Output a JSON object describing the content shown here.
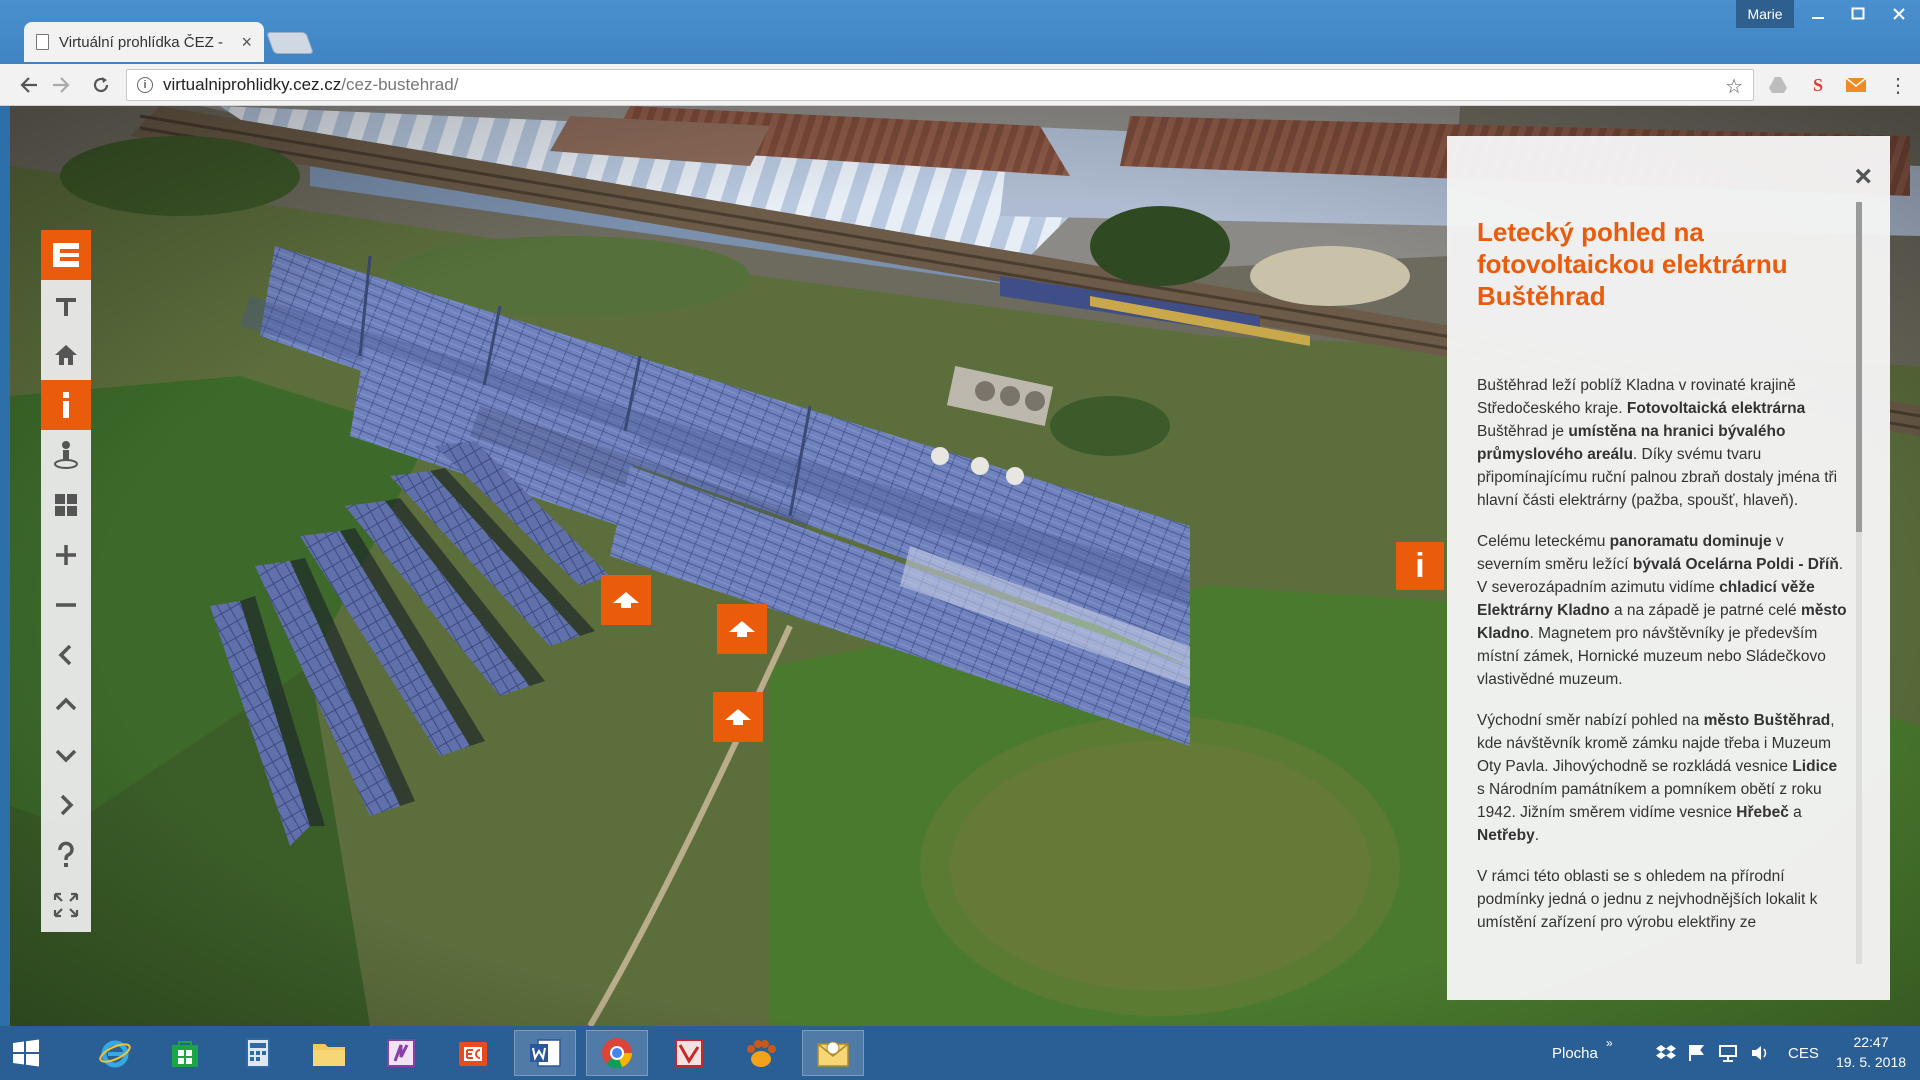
{
  "browser": {
    "tab_title": "Virtuální prohlídka ČEZ -",
    "tab_close": "×",
    "user": "Marie",
    "url_host": "virtualniprohlidky.cez.cz",
    "url_path": "/cez-bustehrad/"
  },
  "panel": {
    "close": "×",
    "title": "Letecký pohled na fotovoltaickou elektrárnu Buštěhrad",
    "p1": [
      {
        "t": "Buštěhrad leží poblíž Kladna v rovinaté krajině Středočeského kraje. "
      },
      {
        "t": "Fotovoltaická elektrárna",
        "b": true
      },
      {
        "t": " Buštěhrad je "
      },
      {
        "t": "umístěna na hranici bývalého průmyslového areálu",
        "b": true
      },
      {
        "t": ". Díky svému tvaru připomínajícímu ruční palnou zbraň dostaly jména tři hlavní části elektrárny (pažba, spoušť, hlaveň)."
      }
    ],
    "p2": [
      {
        "t": "Celému leteckému "
      },
      {
        "t": "panoramatu dominuje",
        "b": true
      },
      {
        "t": " v severním směru ležící "
      },
      {
        "t": "bývalá Ocelárna Poldi - Dříň",
        "b": true
      },
      {
        "t": ". V severozápadním azimutu vidíme "
      },
      {
        "t": "chladicí věže Elektrárny Kladno",
        "b": true
      },
      {
        "t": " a na západě je patrné celé "
      },
      {
        "t": "město Kladno",
        "b": true
      },
      {
        "t": ". Magnetem pro návštěvníky je především místní zámek, Hornické muzeum nebo Sládečkovo vlastivědné muzeum."
      }
    ],
    "p3": [
      {
        "t": "Východní směr nabízí pohled na "
      },
      {
        "t": "město Buštěhrad",
        "b": true
      },
      {
        "t": ", kde návštěvník kromě zámku najde třeba i Muzeum Oty Pavla. Jihovýchodně se rozkládá vesnice "
      },
      {
        "t": "Lidice",
        "b": true
      },
      {
        "t": " s Národním památníkem a pomníkem obětí z roku 1942. Jižním směrem vidíme vesnice "
      },
      {
        "t": "Hřebeč",
        "b": true
      },
      {
        "t": " a "
      },
      {
        "t": "Netřeby",
        "b": true
      },
      {
        "t": "."
      }
    ],
    "p4": [
      {
        "t": "V rámci této oblasti se s ohledem na přírodní podmínky jedná o jednu z nejvhodnějších lokalit k umístění zařízení pro výrobu elektřiny ze"
      }
    ]
  },
  "hotspot_info_label": "i",
  "toolbar_icons": [
    "cez-logo-icon",
    "fullscreen-pin-icon",
    "home-icon",
    "info-icon",
    "tour-guide-icon",
    "thumbnails-icon",
    "zoom-in-icon",
    "zoom-out-icon",
    "pan-left-icon",
    "pan-up-icon",
    "pan-down-icon",
    "pan-right-icon",
    "help-icon",
    "fullscreen-icon"
  ],
  "taskbar": {
    "desktop_label": "Plocha",
    "lang": "CES",
    "time": "22:47",
    "date": "19. 5. 2018"
  },
  "colors": {
    "accent": "#ea5b0c",
    "taskbar": "#2a5f96"
  }
}
